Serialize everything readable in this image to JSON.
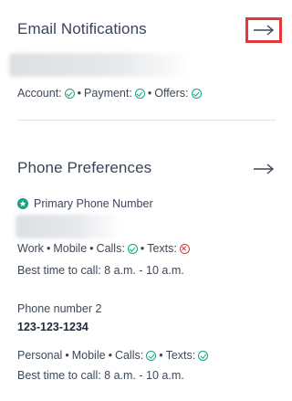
{
  "email": {
    "title": "Email Notifications",
    "account_label": "Account:",
    "payment_label": "Payment:",
    "offers_label": "Offers:",
    "bullet": "•"
  },
  "phone": {
    "title": "Phone Preferences",
    "primary_label": "Primary Phone Number",
    "primary": {
      "type": "Work",
      "kind": "Mobile",
      "calls_label": "Calls:",
      "texts_label": "Texts:",
      "best_time": "Best time to call: 8 a.m. - 10 a.m."
    },
    "second_label": "Phone number 2",
    "second_number": "123-123-1234",
    "second": {
      "type": "Personal",
      "kind": "Mobile",
      "calls_label": "Calls:",
      "texts_label": "Texts:",
      "best_time": "Best time to call: 8 a.m. - 10 a.m."
    }
  },
  "icons": {
    "arrow": "right-arrow-icon",
    "check": "check-circle-icon",
    "cross": "x-circle-icon",
    "star": "star-badge-icon"
  },
  "colors": {
    "success": "#16a37f",
    "error": "#e0393e",
    "highlight": "#e0393e"
  }
}
